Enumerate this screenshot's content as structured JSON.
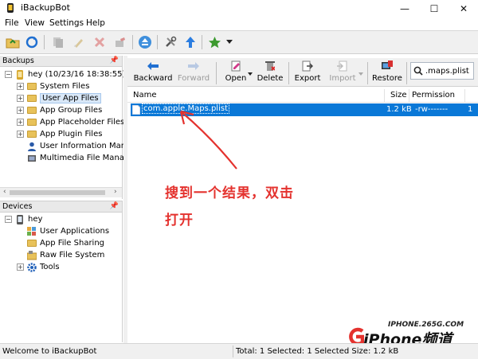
{
  "window": {
    "title": "iBackupBot",
    "minimize_glyph": "—",
    "maximize_glyph": "☐",
    "close_glyph": "✕"
  },
  "menu": [
    "File",
    "View",
    "Settings",
    "Help"
  ],
  "toolbar_icons": [
    "open-folder-icon",
    "refresh-icon",
    "copy-icon",
    "clean-icon",
    "delete-icon",
    "edit-icon",
    "eject-icon",
    "tools-icon",
    "upload-icon",
    "star-icon",
    "dropdown-arrow-icon"
  ],
  "backups_panel": {
    "title": "Backups",
    "root": "hey (10/23/16 18:38:55)",
    "items": [
      {
        "label": "System Files",
        "type": "folder"
      },
      {
        "label": "User App Files",
        "type": "folder",
        "selected": true
      },
      {
        "label": "App Group Files",
        "type": "folder"
      },
      {
        "label": "App Placeholder Files",
        "type": "folder"
      },
      {
        "label": "App Plugin Files",
        "type": "folder"
      },
      {
        "label": "User Information Mana",
        "type": "user"
      },
      {
        "label": "Multimedia File Manag",
        "type": "media"
      }
    ]
  },
  "devices_panel": {
    "title": "Devices",
    "root": "hey",
    "items": [
      {
        "label": "User Applications",
        "type": "apps"
      },
      {
        "label": "App File Sharing",
        "type": "sharing"
      },
      {
        "label": "Raw File System",
        "type": "raw"
      },
      {
        "label": "Tools",
        "type": "tools"
      }
    ]
  },
  "file_toolbar": {
    "backward": "Backward",
    "forward": "Forward",
    "open": "Open",
    "delete": "Delete",
    "export": "Export",
    "import": "Import",
    "restore": "Restore",
    "search_value": ".maps.plist"
  },
  "table": {
    "columns": [
      "Name",
      "Size",
      "Permission"
    ],
    "rows": [
      {
        "name": "com.apple.Maps.plist",
        "size": "1.2 kB",
        "permission": "-rw-------",
        "extra": "1"
      }
    ]
  },
  "status": {
    "left": "Welcome to iBackupBot",
    "right": "Total: 1 Selected: 1 Selected Size: 1.2 kB"
  },
  "annotation": {
    "line1": "搜到一个结果，双击",
    "line2": "打开",
    "color": "#e4322e"
  },
  "watermark": {
    "site": "IPHONE.265G.COM",
    "brand": "iPhone频道"
  },
  "colors": {
    "selection": "#0a78d7",
    "toolbar_bg": "#f0f0f0"
  }
}
